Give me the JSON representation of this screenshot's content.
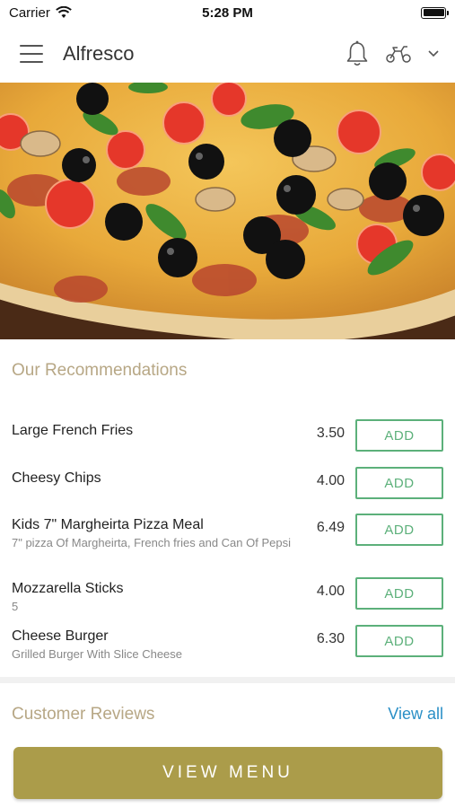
{
  "status_bar": {
    "carrier": "Carrier",
    "time": "5:28 PM"
  },
  "header": {
    "title": "Alfresco",
    "icons": [
      "menu-icon",
      "bell-icon",
      "scooter-icon",
      "chevron-down-icon"
    ]
  },
  "recommendations": {
    "title": "Our Recommendations",
    "add_label": "ADD",
    "items": [
      {
        "name": "Large French Fries",
        "desc": "",
        "price": "3.50"
      },
      {
        "name": "Cheesy Chips",
        "desc": "",
        "price": "4.00"
      },
      {
        "name": "Kids 7\" Margheirta Pizza Meal",
        "desc": "7\" pizza Of Margheirta, French fries and Can Of Pepsi",
        "price": "6.49"
      },
      {
        "name": "Mozzarella Sticks",
        "desc": "5",
        "price": "4.00"
      },
      {
        "name": "Cheese Burger",
        "desc": "Grilled Burger With Slice Cheese",
        "price": "6.30"
      }
    ]
  },
  "reviews": {
    "title": "Customer Reviews",
    "view_all": "View all"
  },
  "footer": {
    "view_menu": "VIEW MENU"
  },
  "colors": {
    "accent_gold": "#ab9c4a",
    "add_green": "#5cb07a",
    "link_blue": "#2a8fc6",
    "section_title": "#b7a785"
  }
}
